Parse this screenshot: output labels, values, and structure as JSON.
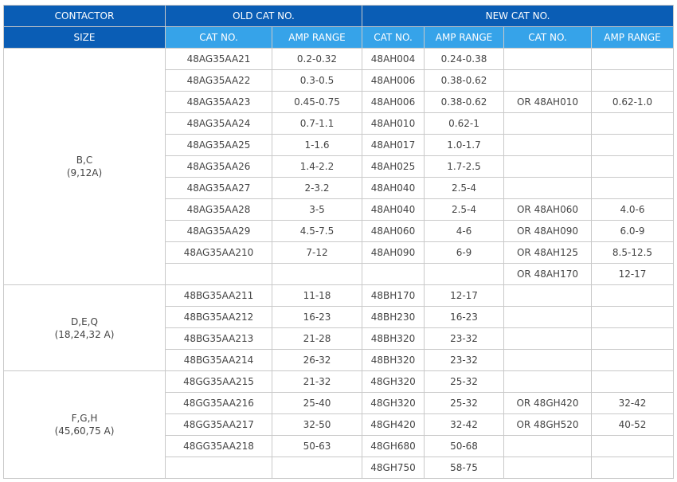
{
  "header": {
    "contactor": "CONTACTOR",
    "size": "SIZE",
    "old_cat": "OLD CAT NO.",
    "new_cat": "NEW CAT NO.",
    "cat_no": "CAT NO.",
    "amp_range": "AMP RANGE"
  },
  "groups": [
    {
      "label": "B,C",
      "sublabel": "(9,12A)",
      "rows": [
        [
          "48AG35AA21",
          "0.2-0.32",
          "48AH004",
          "0.24-0.38",
          "",
          ""
        ],
        [
          "48AG35AA22",
          "0.3-0.5",
          "48AH006",
          "0.38-0.62",
          "",
          ""
        ],
        [
          "48AG35AA23",
          "0.45-0.75",
          "48AH006",
          "0.38-0.62",
          "OR 48AH010",
          "0.62-1.0"
        ],
        [
          "48AG35AA24",
          "0.7-1.1",
          "48AH010",
          "0.62-1",
          "",
          ""
        ],
        [
          "48AG35AA25",
          "1-1.6",
          "48AH017",
          "1.0-1.7",
          "",
          ""
        ],
        [
          "48AG35AA26",
          "1.4-2.2",
          "48AH025",
          "1.7-2.5",
          "",
          ""
        ],
        [
          "48AG35AA27",
          "2-3.2",
          "48AH040",
          "2.5-4",
          "",
          ""
        ],
        [
          "48AG35AA28",
          "3-5",
          "48AH040",
          "2.5-4",
          "OR 48AH060",
          "4.0-6"
        ],
        [
          "48AG35AA29",
          "4.5-7.5",
          "48AH060",
          "4-6",
          "OR 48AH090",
          "6.0-9"
        ],
        [
          "48AG35AA210",
          "7-12",
          "48AH090",
          "6-9",
          "OR 48AH125",
          "8.5-12.5"
        ],
        [
          "",
          "",
          "",
          "",
          "OR 48AH170",
          "12-17"
        ]
      ]
    },
    {
      "label": "D,E,Q",
      "sublabel": "(18,24,32 A)",
      "rows": [
        [
          "48BG35AA211",
          "11-18",
          "48BH170",
          "12-17",
          "",
          ""
        ],
        [
          "48BG35AA212",
          "16-23",
          "48BH230",
          "16-23",
          "",
          ""
        ],
        [
          "48BG35AA213",
          "21-28",
          "48BH320",
          "23-32",
          "",
          ""
        ],
        [
          "48BG35AA214",
          "26-32",
          "48BH320",
          "23-32",
          "",
          ""
        ]
      ]
    },
    {
      "label": "F,G,H",
      "sublabel": "(45,60,75 A)",
      "rows": [
        [
          "48GG35AA215",
          "21-32",
          "48GH320",
          "25-32",
          "",
          ""
        ],
        [
          "48GG35AA216",
          "25-40",
          "48GH320",
          "25-32",
          "OR 48GH420",
          "32-42"
        ],
        [
          "48GG35AA217",
          "32-50",
          "48GH420",
          "32-42",
          "OR 48GH520",
          "40-52"
        ],
        [
          "48GG35AA218",
          "50-63",
          "48GH680",
          "50-68",
          "",
          ""
        ],
        [
          "",
          "",
          "48GH750",
          "58-75",
          "",
          ""
        ]
      ]
    }
  ]
}
